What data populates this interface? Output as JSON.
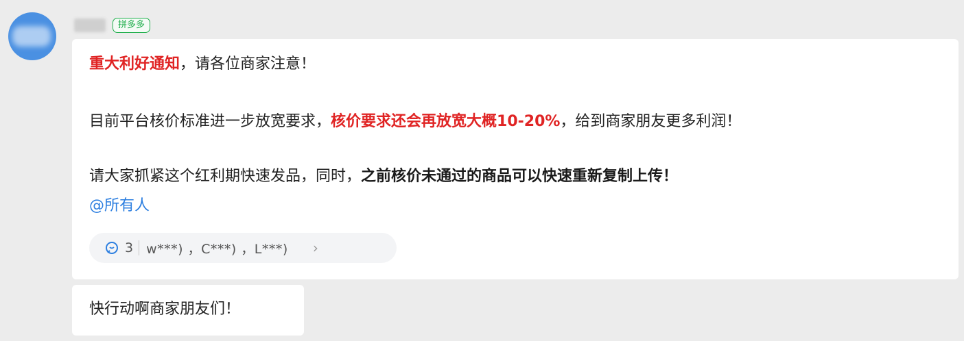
{
  "sender": {
    "badge": "拼多多"
  },
  "message": {
    "line1": {
      "highlight": "重大利好通知",
      "rest": "，请各位商家注意！"
    },
    "line2": {
      "prefix": "目前平台核价标准进一步放宽要求，",
      "highlight": "核价要求还会再放宽大概10-20%",
      "suffix": "，给到商家朋友更多利润！"
    },
    "line3": {
      "prefix": "请大家抓紧这个红利期快速发品，同时，",
      "bold": "之前核价未通过的商品可以快速重新复制上传！"
    },
    "mention": "@所有人"
  },
  "reactions": {
    "icon": "reply-icon",
    "count": "3",
    "users": "w***) ，C***) ，L***)",
    "chevron": "›"
  },
  "second_message": {
    "text": "快行动啊商家朋友们！"
  },
  "colors": {
    "accent_red": "#e02424",
    "mention_blue": "#2d7fe0",
    "badge_green": "#1fae4b",
    "avatar_blue": "#4a90e2"
  }
}
